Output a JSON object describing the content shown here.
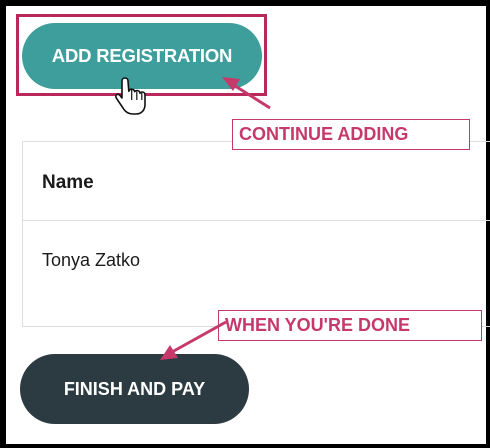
{
  "add_button": {
    "label": "ADD REGISTRATION"
  },
  "callouts": {
    "continue_adding": "CONTINUE ADDING",
    "when_done": "WHEN YOU'RE DONE"
  },
  "table": {
    "header": "Name",
    "rows": [
      {
        "name": "Tonya Zatko"
      }
    ]
  },
  "finish_button": {
    "label": "FINISH AND PAY"
  },
  "icons": {
    "cursor": "hand-pointer-icon",
    "arrows": "annotation-arrow-icon"
  },
  "colors": {
    "teal_button": "#3e9e9b",
    "dark_button": "#2c3a42",
    "annotation": "#c6396b",
    "outline": "#b8285a"
  }
}
